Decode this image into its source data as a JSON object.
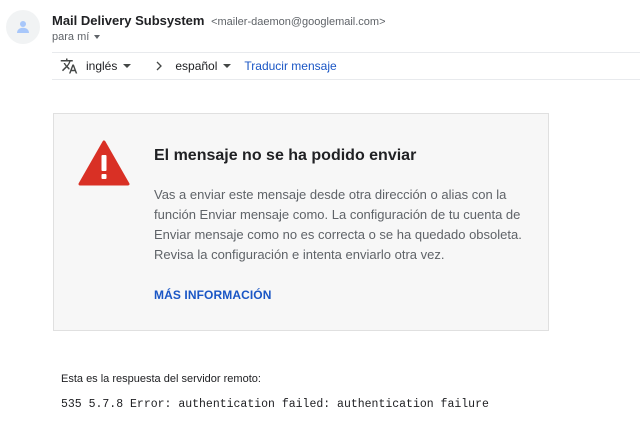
{
  "header": {
    "sender_name": "Mail Delivery Subsystem",
    "sender_email": "<mailer-daemon@googlemail.com>",
    "recipient": "para mí",
    "avatar_icon": "person-icon"
  },
  "translate_bar": {
    "icon": "translate-icon",
    "source_language": "inglés",
    "target_language": "español",
    "translate_link": "Traducir mensaje"
  },
  "error_card": {
    "icon": "warning-icon",
    "icon_color": "#d93025",
    "title": "El mensaje no se ha podido enviar",
    "body": "Vas a enviar este mensaje desde otra dirección o alias con la función Enviar mensaje como. La configuración de tu cuenta de Enviar mensaje como no es correcta o se ha quedado obsoleta. Revisa la configuración e intenta enviarlo otra vez.",
    "more_info_label": "MÁS INFORMACIÓN"
  },
  "server_response": {
    "label": "Esta es la respuesta del servidor remoto:",
    "code": "535 5.7.8 Error: authentication failed: authentication failure"
  },
  "colors": {
    "link": "#1a56c5",
    "error_red": "#d93025",
    "card_background": "#f7f7f7"
  }
}
